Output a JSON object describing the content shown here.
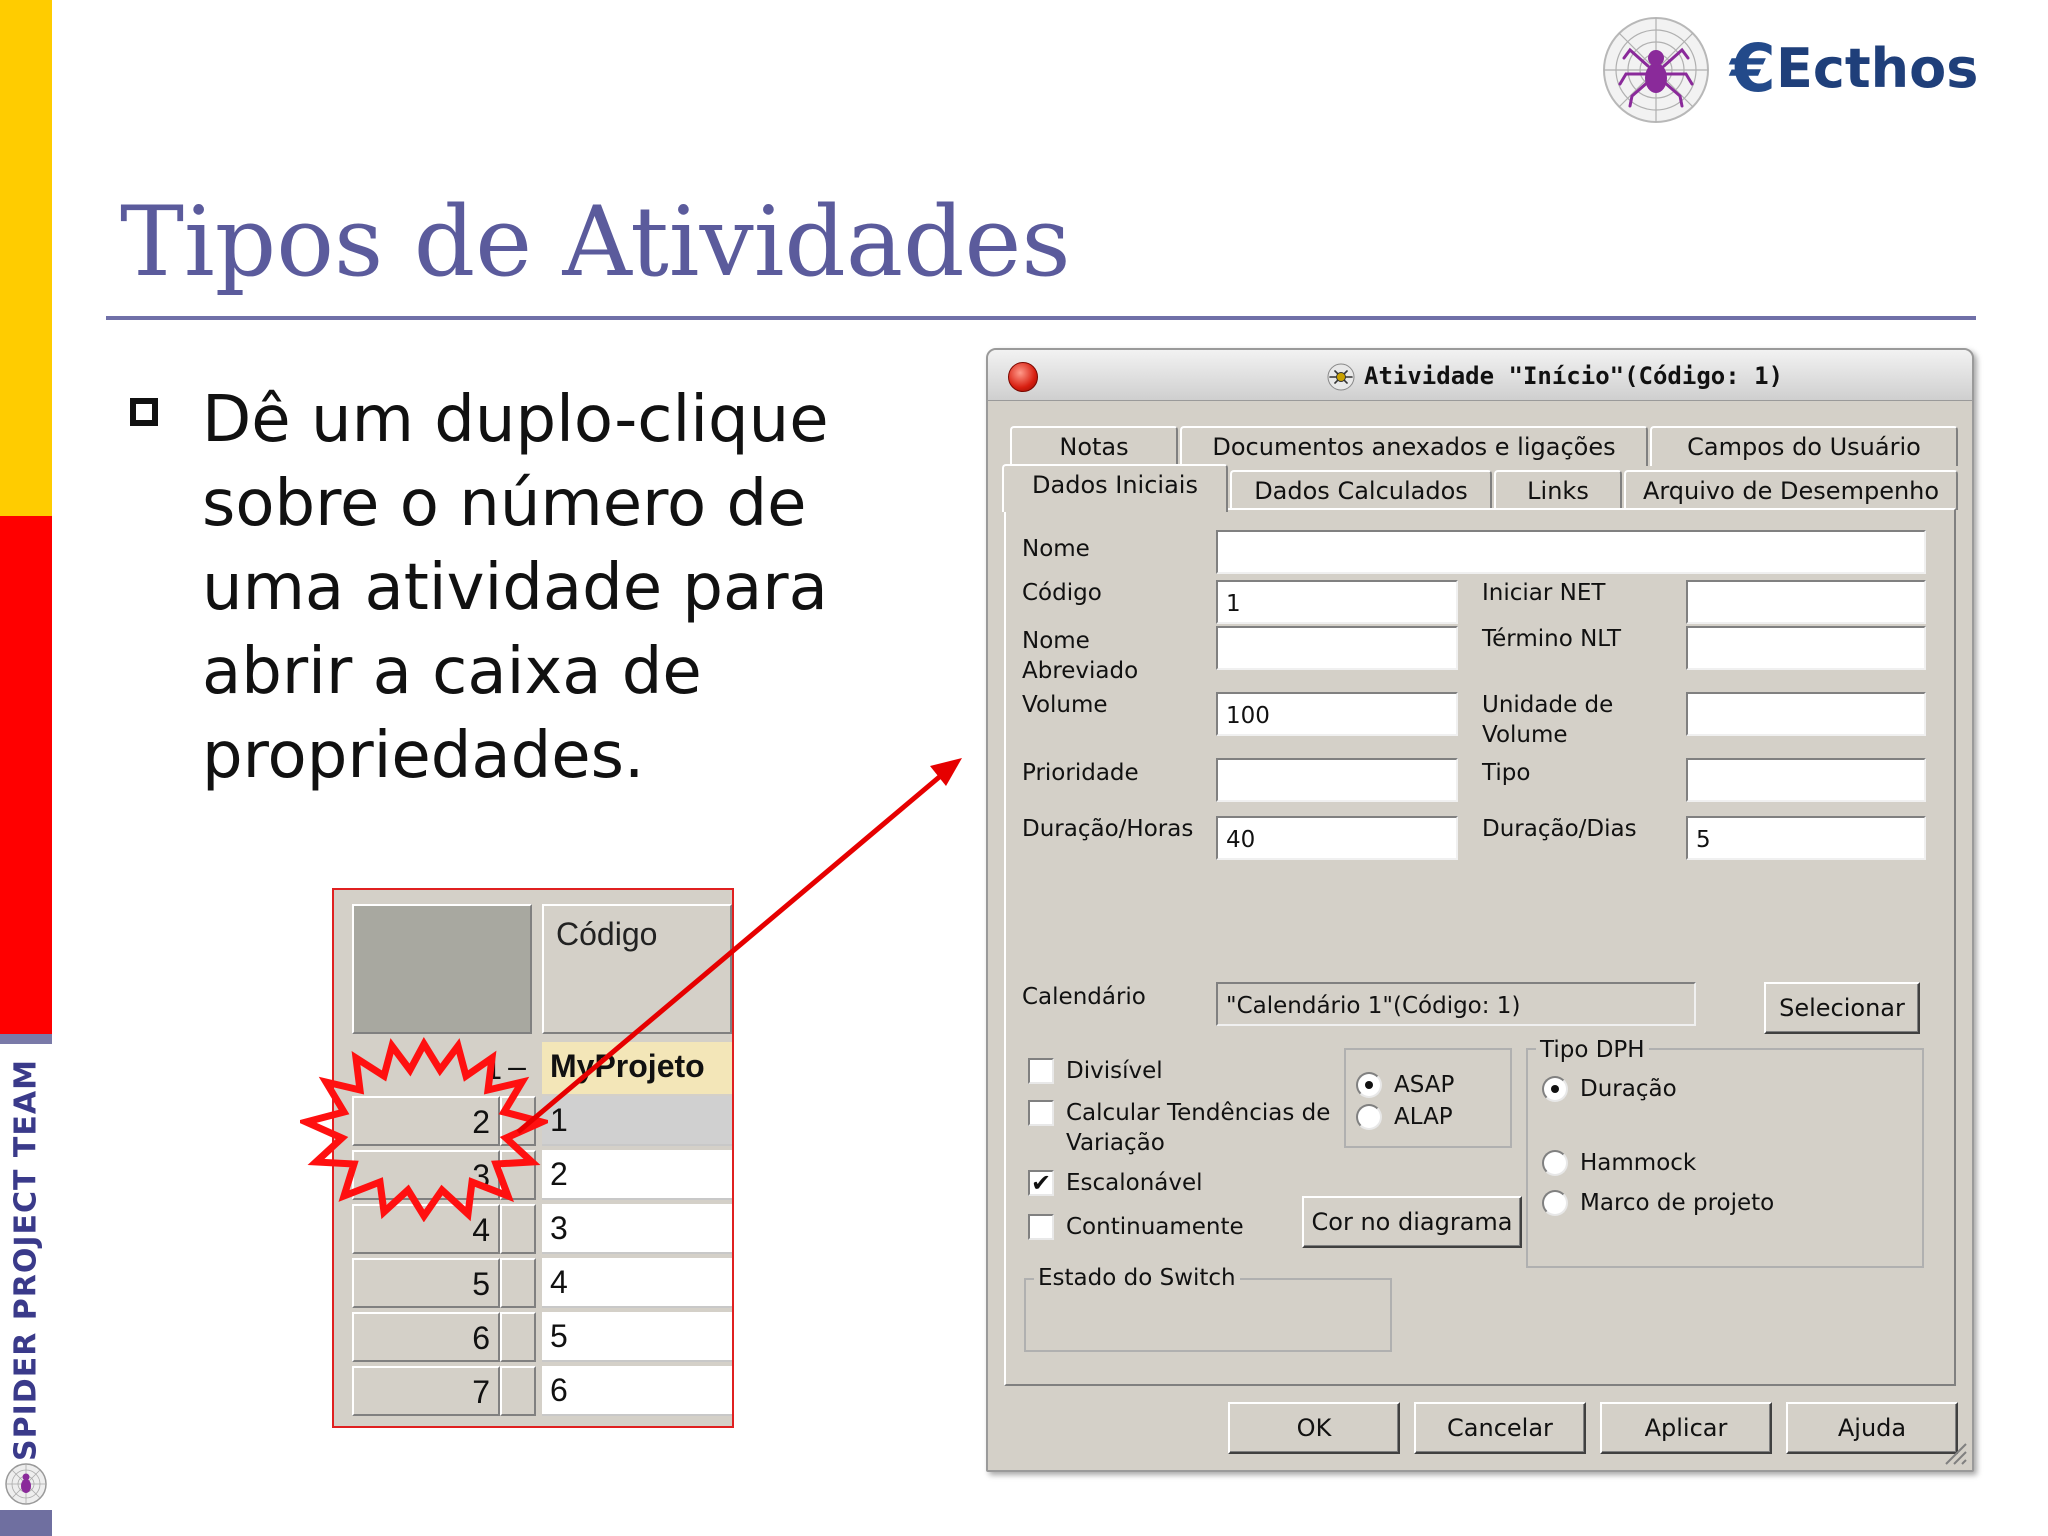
{
  "slide": {
    "title": "Tipos de Atividades",
    "bullet": "Dê um duplo-clique sobre o número de uma atividade para abrir a caixa de propriedades.",
    "sidebar_label": "SPIDER PROJECT TEAM",
    "brand": "Ecthos",
    "brand_mark": "€"
  },
  "colors": {
    "title": "#5b5b9c",
    "strip_yellow": "#ffcc00",
    "strip_red": "#ff0000",
    "arrow": "#e60000",
    "brand": "#1f3f7a"
  },
  "grid": {
    "header_code": "Código",
    "project_number": "1",
    "project_minus": "–",
    "project_name": "MyProjeto",
    "rows": [
      {
        "num": "2",
        "code": "1"
      },
      {
        "num": "3",
        "code": "2"
      },
      {
        "num": "4",
        "code": "3"
      },
      {
        "num": "5",
        "code": "4"
      },
      {
        "num": "6",
        "code": "5"
      },
      {
        "num": "7",
        "code": "6"
      }
    ]
  },
  "dialog": {
    "title": "Atividade \"Início\"(Código: 1)",
    "tabs_row1": [
      "Notas",
      "Documentos anexados e ligações",
      "Campos do Usuário"
    ],
    "tabs_row2": [
      "Dados Iniciais",
      "Dados Calculados",
      "Links",
      "Arquivo de Desempenho"
    ],
    "labels": {
      "nome": "Nome",
      "codigo": "Código",
      "nome_abrev": "Nome Abreviado",
      "volume": "Volume",
      "prioridade": "Prioridade",
      "duracao_horas": "Duração/Horas",
      "iniciar_net": "Iniciar NET",
      "termino_nlt": "Término NLT",
      "unidade_volume": "Unidade de Volume",
      "tipo": "Tipo",
      "duracao_dias": "Duração/Dias",
      "calendario": "Calendário"
    },
    "values": {
      "nome": "",
      "codigo": "1",
      "nome_abrev": "",
      "volume": "100",
      "prioridade": "",
      "duracao_horas": "40",
      "iniciar_net": "",
      "termino_nlt": "",
      "unidade_volume": "",
      "tipo": "",
      "duracao_dias": "5",
      "calendario": "\"Calendário 1\"(Código: 1)"
    },
    "checkboxes": [
      {
        "label": "Divisível",
        "checked": false
      },
      {
        "label": "Calcular Tendências de Variação",
        "checked": false
      },
      {
        "label": "Escalonável",
        "checked": true
      },
      {
        "label": "Continuamente",
        "checked": false
      }
    ],
    "check_mark": "✔",
    "schedule_radios": [
      {
        "label": "ASAP",
        "selected": true
      },
      {
        "label": "ALAP",
        "selected": false
      }
    ],
    "tipo_dph": {
      "legend": "Tipo DPH",
      "options": [
        {
          "label": "Duração",
          "selected": true
        },
        {
          "label": "Hammock",
          "selected": false
        },
        {
          "label": "Marco de projeto",
          "selected": false
        }
      ]
    },
    "estado_switch_legend": "Estado do Switch",
    "buttons": {
      "selecionar": "Selecionar",
      "cor_diagrama": "Cor no diagrama",
      "ok": "OK",
      "cancelar": "Cancelar",
      "aplicar": "Aplicar",
      "ajuda": "Ajuda"
    }
  }
}
